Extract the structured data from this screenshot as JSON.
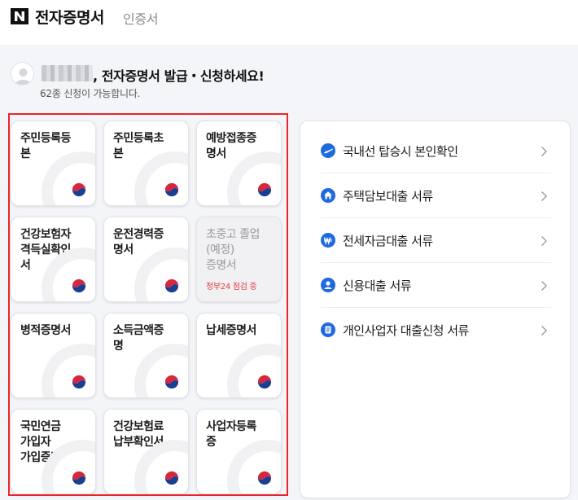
{
  "header": {
    "title": "전자증명서",
    "subtitle": "인증서",
    "logo_icon": "naver-n-logo"
  },
  "greeting": {
    "text": ", 전자증명서 발급・신청하세요!",
    "count_text": "62종 신청이 가능합니다."
  },
  "documents": [
    {
      "label": "주민등록등\n본",
      "icon": "korea-emblem-icon"
    },
    {
      "label": "주민등록초\n본",
      "icon": "korea-emblem-icon"
    },
    {
      "label": "예방접종증\n명서",
      "icon": "korea-emblem-icon"
    },
    {
      "label": "건강보험자\n격득실확인\n서",
      "icon": "korea-emblem-icon"
    },
    {
      "label": "운전경력증\n명서",
      "icon": "korea-emblem-icon"
    },
    {
      "label": "초중고 졸업\n(예정)\n증명서",
      "icon": "",
      "disabled": true,
      "notice": "정부24 점검 중"
    },
    {
      "label": "병적증명서",
      "icon": "korea-emblem-icon"
    },
    {
      "label": "소득금액증\n명",
      "icon": "korea-emblem-icon"
    },
    {
      "label": "납세증명서",
      "icon": "korea-emblem-icon"
    },
    {
      "label": "국민연금\n가입자\n가입증명",
      "icon": "korea-emblem-icon"
    },
    {
      "label": "건강보험료\n납부확인서",
      "icon": "korea-emblem-icon"
    },
    {
      "label": "사업자등록\n증",
      "icon": "korea-emblem-icon"
    }
  ],
  "menu": {
    "items": [
      {
        "label": "국내선 탑승시 본인확인",
        "icon": "airplane-icon"
      },
      {
        "label": "주택담보대출 서류",
        "icon": "house-icon"
      },
      {
        "label": "전세자금대출 서류",
        "icon": "won-icon"
      },
      {
        "label": "신용대출 서류",
        "icon": "person-icon"
      },
      {
        "label": "개인사업자 대출신청 서류",
        "icon": "document-icon"
      }
    ]
  },
  "colors": {
    "accent": "#1f6ae0",
    "highlight_box": "#e8262a",
    "notice": "#e23b3b",
    "background": "#f4f5f8"
  }
}
